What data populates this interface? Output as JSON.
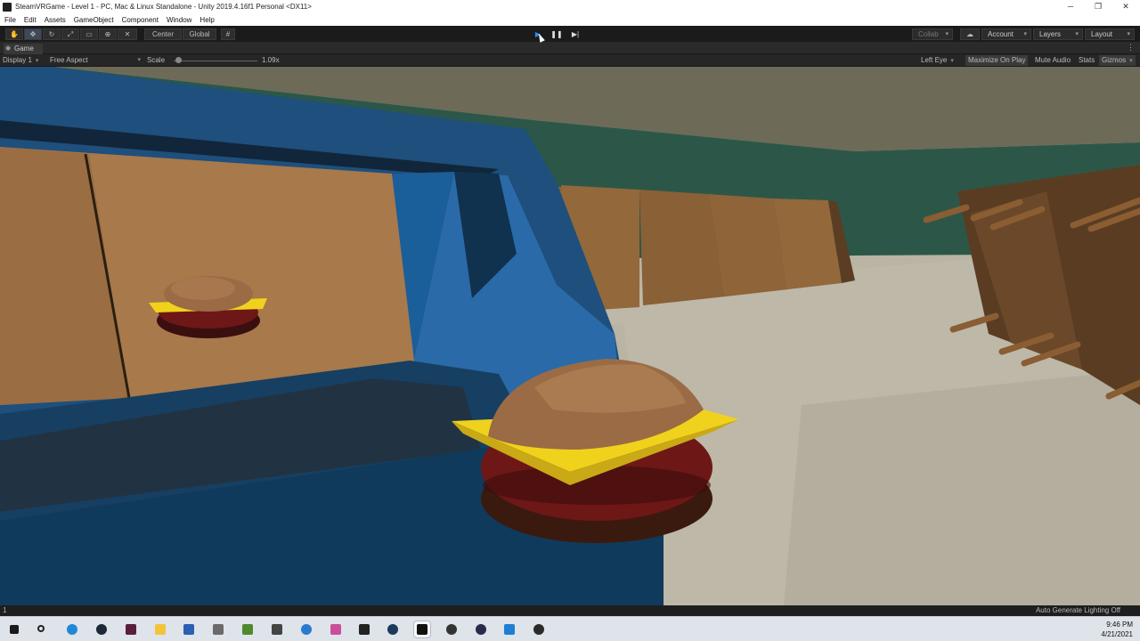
{
  "window": {
    "title": "SteamVRGame - Level 1 - PC, Mac & Linux Standalone - Unity 2019.4.16f1 Personal <DX11>",
    "minimize": "─",
    "restore": "❐",
    "close": "✕"
  },
  "menu": [
    "File",
    "Edit",
    "Assets",
    "GameObject",
    "Component",
    "Window",
    "Help"
  ],
  "toolbar": {
    "pivot_label": "Center",
    "space_label": "Global",
    "collab_label": "Collab",
    "account_label": "Account",
    "layers_label": "Layers",
    "layout_label": "Layout"
  },
  "game_tab": {
    "label": "Game"
  },
  "game_bar": {
    "display": "Display 1",
    "aspect": "Free Aspect",
    "scale_label": "Scale",
    "scale_value": "1.09x",
    "scale_fraction": 0.06,
    "eye": "Left Eye",
    "maximize": "Maximize On Play",
    "mute": "Mute Audio",
    "stats": "Stats",
    "gizmos": "Gizmos"
  },
  "status": {
    "left": "1",
    "right": "Auto Generate Lighting Off"
  },
  "clock": {
    "time": "9:46 PM",
    "date": "4/21/2021"
  },
  "colors": {
    "play_active": "#2d8cf0",
    "wall": "#2c5748",
    "floor": "#bdb8a8",
    "counter": "#1e4f7d",
    "bun": "#9a6b45",
    "cheese": "#f0d21c",
    "patty": "#6e1717",
    "panel": "#8a6037"
  }
}
